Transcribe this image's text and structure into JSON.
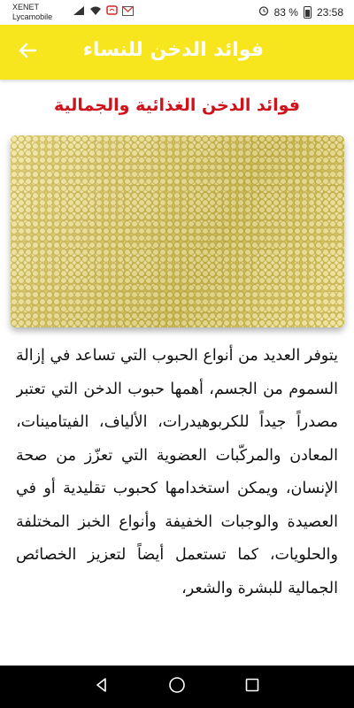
{
  "status_bar": {
    "carrier_line1": "XENET",
    "carrier_line2": "Lycamobile",
    "battery": "83 %",
    "time": "23:58",
    "icons": [
      "signal-icon",
      "wifi-icon",
      "notification-icon",
      "gmail-icon",
      "alarm-icon",
      "battery-icon"
    ]
  },
  "app_bar": {
    "title": "فوائد الدخن للنساء",
    "back_icon": "arrow-left-icon",
    "background": "#f7e51d"
  },
  "content": {
    "section_title": "فوائد الدخن الغذائية والجمالية",
    "section_title_color": "#d0121b",
    "image": "millet-grains-photo",
    "article_text": "يتوفر العديد من أنواع الحبوب التي تساعد في إزالة السموم من الجسم، أهمها حبوب الدخن التي تعتبر مصدراً جيداً للكربوهيدرات، الألياف، الفيتامينات، المعادن والمركّبات العضوية التي تعزّز من صحة الإنسان، ويمكن استخدامها كحبوب تقليدية أو في العصيدة والوجبات الخفيفة وأنواع الخبز المختلفة والحلويات، كما تستعمل أيضاً لتعزيز الخصائص الجمالية للبشرة والشعر،"
  },
  "nav_bar": {
    "buttons": [
      "back-triangle-icon",
      "home-circle-icon",
      "recents-square-icon"
    ]
  }
}
